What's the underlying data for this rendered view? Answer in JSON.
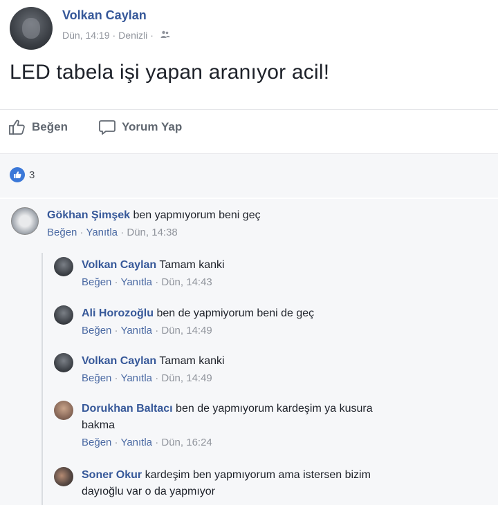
{
  "post": {
    "author": "Volkan Caylan",
    "time": "Dün, 14:19",
    "location": "Denizli",
    "separator": "·",
    "privacy_icon": "friends-icon",
    "text": "LED tabela işi yapan aranıyor acil!"
  },
  "actions": {
    "like": "Beğen",
    "comment": "Yorum Yap"
  },
  "reactions": {
    "count": "3",
    "icon": "like-icon"
  },
  "comments": [
    {
      "author": "Gökhan Şimşek",
      "text": "ben yapmıyorum beni geç",
      "like": "Beğen",
      "reply": "Yanıtla",
      "time": "Dün, 14:38"
    }
  ],
  "replies": [
    {
      "author": "Volkan Caylan",
      "text": "Tamam kanki",
      "like": "Beğen",
      "reply": "Yanıtla",
      "time": "Dün, 14:43"
    },
    {
      "author": "Ali Horozoğlu",
      "text": "ben de yapmiyorum beni de geç",
      "like": "Beğen",
      "reply": "Yanıtla",
      "time": "Dün, 14:49"
    },
    {
      "author": "Volkan Caylan",
      "text": "Tamam kanki",
      "like": "Beğen",
      "reply": "Yanıtla",
      "time": "Dün, 14:49"
    },
    {
      "author": "Dorukhan Baltacı",
      "text": "ben de yapmıyorum kardeşim ya kusura",
      "text2": "bakma",
      "like": "Beğen",
      "reply": "Yanıtla",
      "time": "Dün, 16:24"
    },
    {
      "author": "Soner Okur",
      "text": "kardeşim ben yapmıyorum ama istersen bizim",
      "text2": "dayıoğlu var o da yapmıyor"
    }
  ],
  "colors": {
    "name_blue": "#365899",
    "meta_gray": "#90949c",
    "like_blue": "#3b78d8"
  }
}
